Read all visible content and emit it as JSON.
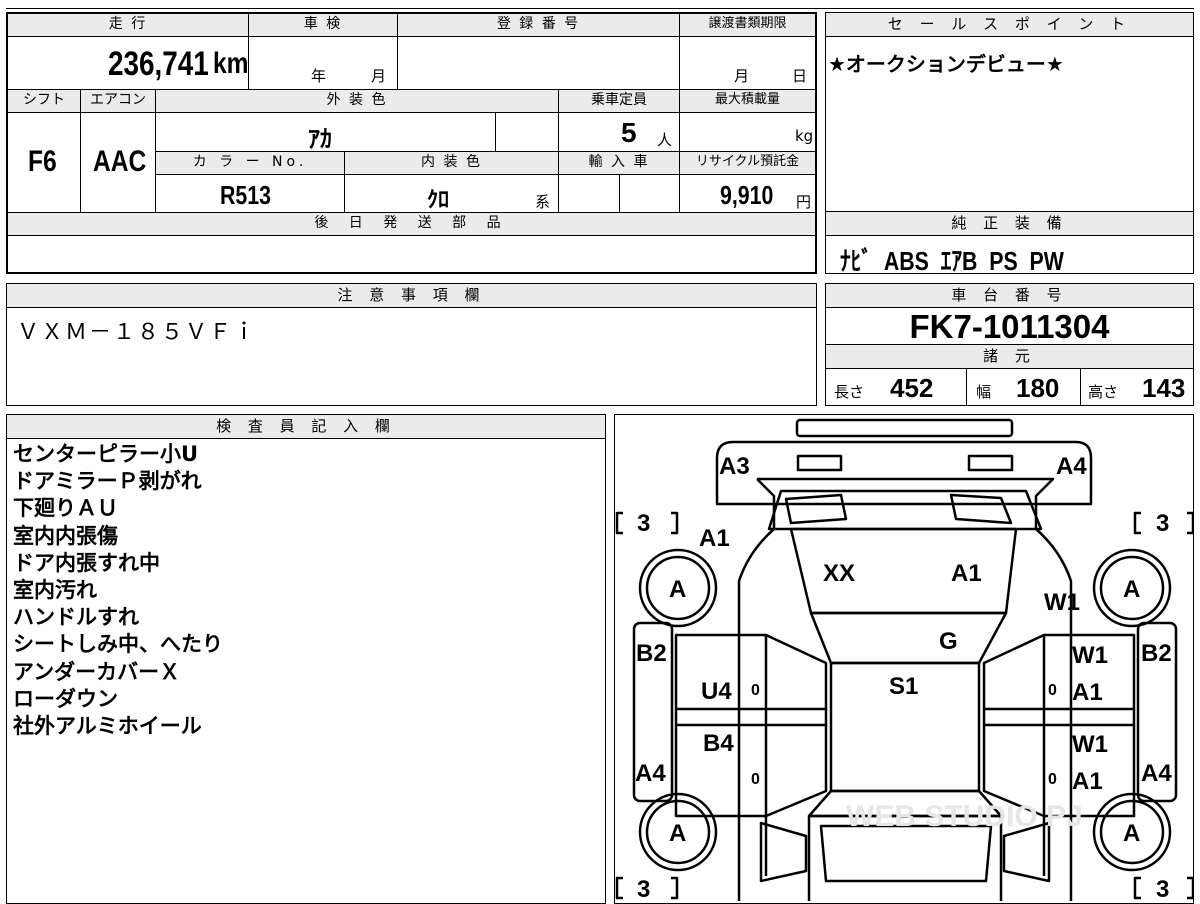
{
  "vehicle": {
    "mileage_label": "走 行",
    "mileage_value": "236,741",
    "mileage_unit": "km",
    "inspection_label": "車 検",
    "year_unit": "年",
    "month_unit": "月",
    "registration_label": "登 録 番 号",
    "transfer_label": "譲渡書類期限",
    "day_unit": "日",
    "shift_label": "シフト",
    "shift_value": "F6",
    "aircon_label": "エアコン",
    "aircon_value": "AAC",
    "exterior_color_label": "外 装 色",
    "exterior_color_value": "ｱｶ",
    "capacity_label": "乗車定員",
    "capacity_value": "5",
    "capacity_unit": "人",
    "max_load_label": "最大積載量",
    "max_load_unit": "kg",
    "color_no_label": "カ ラ ー No.",
    "color_no_value": "R513",
    "interior_color_label": "内 装 色",
    "interior_color_value": "ｸﾛ",
    "interior_suffix": "系",
    "import_label": "輸 入 車",
    "recycle_label": "リサイクル預託金",
    "recycle_value": "9,910",
    "recycle_unit": "円",
    "later_parts_label": "後 日 発 送 部 品"
  },
  "sales_point": {
    "label": "セ ー ル ス ポ イ ン ト",
    "text": "★オークションデビュー★"
  },
  "equipment": {
    "label": "純 正 装 備",
    "text": "ﾅﾋﾞ  ABS  ｴｱB  PS  PW"
  },
  "notes": {
    "label": "注 意 事 項 欄",
    "text": "ＶＸＭ－１８５ＶＦｉ"
  },
  "chassis": {
    "label": "車 台 番 号",
    "value": "FK7-1011304",
    "specs_label": "諸 元",
    "length_label": "長さ",
    "length_value": "452",
    "width_label": "幅",
    "width_value": "180",
    "height_label": "高さ",
    "height_value": "143"
  },
  "inspector": {
    "label": "検 査 員 記 入 欄",
    "lines": [
      "センターピラー小U",
      "ドアミラーＰ剥がれ",
      "下廻りＡＵ",
      "室内内張傷",
      "ドア内張すれ中",
      "室内汚れ",
      "ハンドルすれ",
      "シートしみ中、へたり",
      "アンダーカバーＸ",
      "ローダウン",
      "社外アルミホイール"
    ]
  },
  "diagram": {
    "tires": [
      "3",
      "3",
      "3",
      "3"
    ],
    "wheel_mark": "A",
    "marks": {
      "a3": "A3",
      "a4_top": "A4",
      "a1_front_left": "A1",
      "xx": "XX",
      "a1_hood": "A1",
      "w1_front": "W1",
      "g": "G",
      "b2_left": "B2",
      "b2_right": "B2",
      "w1_door_fr": "W1",
      "u4": "U4",
      "s1": "S1",
      "a1_door_fr": "A1",
      "b4": "B4",
      "w1_door_rr": "W1",
      "a1_door_rr": "A1",
      "a4_left": "A4",
      "a4_right": "A4",
      "zero": "0"
    },
    "watermark": "WEB STUDIO PJ"
  }
}
